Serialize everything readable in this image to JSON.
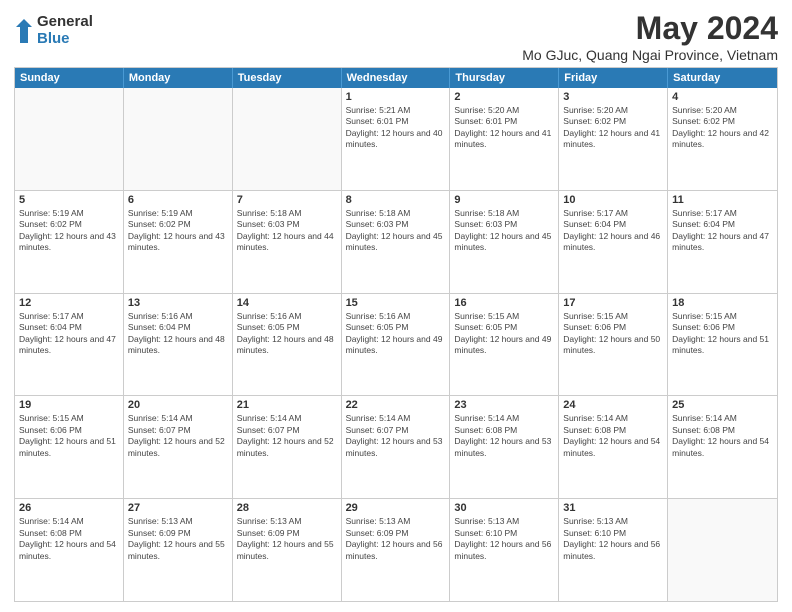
{
  "logo": {
    "general": "General",
    "blue": "Blue"
  },
  "title": "May 2024",
  "subtitle": "Mo GJuc, Quang Ngai Province, Vietnam",
  "days_of_week": [
    "Sunday",
    "Monday",
    "Tuesday",
    "Wednesday",
    "Thursday",
    "Friday",
    "Saturday"
  ],
  "weeks": [
    [
      {
        "day": "",
        "sunrise": "",
        "sunset": "",
        "daylight": ""
      },
      {
        "day": "",
        "sunrise": "",
        "sunset": "",
        "daylight": ""
      },
      {
        "day": "",
        "sunrise": "",
        "sunset": "",
        "daylight": ""
      },
      {
        "day": "1",
        "sunrise": "Sunrise: 5:21 AM",
        "sunset": "Sunset: 6:01 PM",
        "daylight": "Daylight: 12 hours and 40 minutes."
      },
      {
        "day": "2",
        "sunrise": "Sunrise: 5:20 AM",
        "sunset": "Sunset: 6:01 PM",
        "daylight": "Daylight: 12 hours and 41 minutes."
      },
      {
        "day": "3",
        "sunrise": "Sunrise: 5:20 AM",
        "sunset": "Sunset: 6:02 PM",
        "daylight": "Daylight: 12 hours and 41 minutes."
      },
      {
        "day": "4",
        "sunrise": "Sunrise: 5:20 AM",
        "sunset": "Sunset: 6:02 PM",
        "daylight": "Daylight: 12 hours and 42 minutes."
      }
    ],
    [
      {
        "day": "5",
        "sunrise": "Sunrise: 5:19 AM",
        "sunset": "Sunset: 6:02 PM",
        "daylight": "Daylight: 12 hours and 43 minutes."
      },
      {
        "day": "6",
        "sunrise": "Sunrise: 5:19 AM",
        "sunset": "Sunset: 6:02 PM",
        "daylight": "Daylight: 12 hours and 43 minutes."
      },
      {
        "day": "7",
        "sunrise": "Sunrise: 5:18 AM",
        "sunset": "Sunset: 6:03 PM",
        "daylight": "Daylight: 12 hours and 44 minutes."
      },
      {
        "day": "8",
        "sunrise": "Sunrise: 5:18 AM",
        "sunset": "Sunset: 6:03 PM",
        "daylight": "Daylight: 12 hours and 45 minutes."
      },
      {
        "day": "9",
        "sunrise": "Sunrise: 5:18 AM",
        "sunset": "Sunset: 6:03 PM",
        "daylight": "Daylight: 12 hours and 45 minutes."
      },
      {
        "day": "10",
        "sunrise": "Sunrise: 5:17 AM",
        "sunset": "Sunset: 6:04 PM",
        "daylight": "Daylight: 12 hours and 46 minutes."
      },
      {
        "day": "11",
        "sunrise": "Sunrise: 5:17 AM",
        "sunset": "Sunset: 6:04 PM",
        "daylight": "Daylight: 12 hours and 47 minutes."
      }
    ],
    [
      {
        "day": "12",
        "sunrise": "Sunrise: 5:17 AM",
        "sunset": "Sunset: 6:04 PM",
        "daylight": "Daylight: 12 hours and 47 minutes."
      },
      {
        "day": "13",
        "sunrise": "Sunrise: 5:16 AM",
        "sunset": "Sunset: 6:04 PM",
        "daylight": "Daylight: 12 hours and 48 minutes."
      },
      {
        "day": "14",
        "sunrise": "Sunrise: 5:16 AM",
        "sunset": "Sunset: 6:05 PM",
        "daylight": "Daylight: 12 hours and 48 minutes."
      },
      {
        "day": "15",
        "sunrise": "Sunrise: 5:16 AM",
        "sunset": "Sunset: 6:05 PM",
        "daylight": "Daylight: 12 hours and 49 minutes."
      },
      {
        "day": "16",
        "sunrise": "Sunrise: 5:15 AM",
        "sunset": "Sunset: 6:05 PM",
        "daylight": "Daylight: 12 hours and 49 minutes."
      },
      {
        "day": "17",
        "sunrise": "Sunrise: 5:15 AM",
        "sunset": "Sunset: 6:06 PM",
        "daylight": "Daylight: 12 hours and 50 minutes."
      },
      {
        "day": "18",
        "sunrise": "Sunrise: 5:15 AM",
        "sunset": "Sunset: 6:06 PM",
        "daylight": "Daylight: 12 hours and 51 minutes."
      }
    ],
    [
      {
        "day": "19",
        "sunrise": "Sunrise: 5:15 AM",
        "sunset": "Sunset: 6:06 PM",
        "daylight": "Daylight: 12 hours and 51 minutes."
      },
      {
        "day": "20",
        "sunrise": "Sunrise: 5:14 AM",
        "sunset": "Sunset: 6:07 PM",
        "daylight": "Daylight: 12 hours and 52 minutes."
      },
      {
        "day": "21",
        "sunrise": "Sunrise: 5:14 AM",
        "sunset": "Sunset: 6:07 PM",
        "daylight": "Daylight: 12 hours and 52 minutes."
      },
      {
        "day": "22",
        "sunrise": "Sunrise: 5:14 AM",
        "sunset": "Sunset: 6:07 PM",
        "daylight": "Daylight: 12 hours and 53 minutes."
      },
      {
        "day": "23",
        "sunrise": "Sunrise: 5:14 AM",
        "sunset": "Sunset: 6:08 PM",
        "daylight": "Daylight: 12 hours and 53 minutes."
      },
      {
        "day": "24",
        "sunrise": "Sunrise: 5:14 AM",
        "sunset": "Sunset: 6:08 PM",
        "daylight": "Daylight: 12 hours and 54 minutes."
      },
      {
        "day": "25",
        "sunrise": "Sunrise: 5:14 AM",
        "sunset": "Sunset: 6:08 PM",
        "daylight": "Daylight: 12 hours and 54 minutes."
      }
    ],
    [
      {
        "day": "26",
        "sunrise": "Sunrise: 5:14 AM",
        "sunset": "Sunset: 6:08 PM",
        "daylight": "Daylight: 12 hours and 54 minutes."
      },
      {
        "day": "27",
        "sunrise": "Sunrise: 5:13 AM",
        "sunset": "Sunset: 6:09 PM",
        "daylight": "Daylight: 12 hours and 55 minutes."
      },
      {
        "day": "28",
        "sunrise": "Sunrise: 5:13 AM",
        "sunset": "Sunset: 6:09 PM",
        "daylight": "Daylight: 12 hours and 55 minutes."
      },
      {
        "day": "29",
        "sunrise": "Sunrise: 5:13 AM",
        "sunset": "Sunset: 6:09 PM",
        "daylight": "Daylight: 12 hours and 56 minutes."
      },
      {
        "day": "30",
        "sunrise": "Sunrise: 5:13 AM",
        "sunset": "Sunset: 6:10 PM",
        "daylight": "Daylight: 12 hours and 56 minutes."
      },
      {
        "day": "31",
        "sunrise": "Sunrise: 5:13 AM",
        "sunset": "Sunset: 6:10 PM",
        "daylight": "Daylight: 12 hours and 56 minutes."
      },
      {
        "day": "",
        "sunrise": "",
        "sunset": "",
        "daylight": ""
      }
    ]
  ]
}
